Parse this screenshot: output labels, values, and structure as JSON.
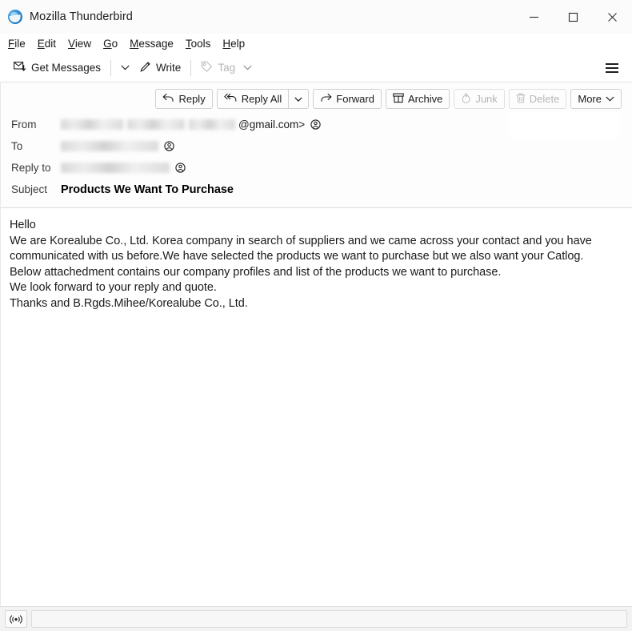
{
  "window": {
    "title": "Mozilla Thunderbird",
    "logo_icon": "thunderbird-logo-icon",
    "minimize_icon": "minimize-icon",
    "maximize_icon": "maximize-icon",
    "close_icon": "close-icon"
  },
  "menubar": {
    "items": [
      {
        "label": "File",
        "accel": "F"
      },
      {
        "label": "Edit",
        "accel": "E"
      },
      {
        "label": "View",
        "accel": "V"
      },
      {
        "label": "Go",
        "accel": "G"
      },
      {
        "label": "Message",
        "accel": "M"
      },
      {
        "label": "Tools",
        "accel": "T"
      },
      {
        "label": "Help",
        "accel": "H"
      }
    ]
  },
  "toolbar": {
    "get_messages_label": "Get Messages",
    "get_messages_icon": "envelope-download-icon",
    "get_messages_chevron": "chevron-down-icon",
    "write_label": "Write",
    "write_icon": "pencil-icon",
    "tag_label": "Tag",
    "tag_icon": "tag-icon",
    "tag_chevron": "chevron-down-icon",
    "app_menu_icon": "hamburger-menu-icon"
  },
  "message_actions": {
    "reply_label": "Reply",
    "reply_icon": "reply-arrow-icon",
    "reply_all_label": "Reply All",
    "reply_all_icon": "reply-all-arrow-icon",
    "reply_all_chevron": "chevron-down-icon",
    "forward_label": "Forward",
    "forward_icon": "forward-arrow-icon",
    "archive_label": "Archive",
    "archive_icon": "archive-box-icon",
    "junk_label": "Junk",
    "junk_icon": "junk-flame-icon",
    "delete_label": "Delete",
    "delete_icon": "trash-icon",
    "more_label": "More",
    "more_chevron": "chevron-down-icon"
  },
  "message_header": {
    "from_label": "From",
    "from_value_visible": "@gmail.com>",
    "from_redacted": true,
    "to_label": "To",
    "to_value_visible": "",
    "to_redacted": true,
    "reply_to_label": "Reply to",
    "reply_to_value_visible": "",
    "reply_to_redacted": true,
    "subject_label": "Subject",
    "subject_value": "Products We Want To Purchase",
    "contact_icon": "contact-person-circle-icon"
  },
  "message_body": {
    "lines": [
      "Hello",
      "We are Korealube Co., Ltd. Korea company in search of suppliers and we came across your contact and you have",
      "communicated with us before.We have selected the products we want to purchase but we also want your Catlog.",
      "Below attachedment contains our company profiles and list of the products we want to purchase.",
      "We look forward to your reply and quote.",
      "Thanks and B.Rgds.Mihee/Korealube Co., Ltd."
    ]
  },
  "statusbar": {
    "connection_icon": "broadcast-signal-icon",
    "message": ""
  },
  "colors": {
    "titlebar_bg": "#fbfbfb",
    "toolbar_bg": "#ffffff",
    "body_bg": "#ffffff",
    "status_bg": "#f3f3f3",
    "text": "#1b1b1b",
    "disabled_text": "#b5b5b5",
    "border": "#dcdcdc",
    "logo_blue": "#2a8ad4"
  }
}
